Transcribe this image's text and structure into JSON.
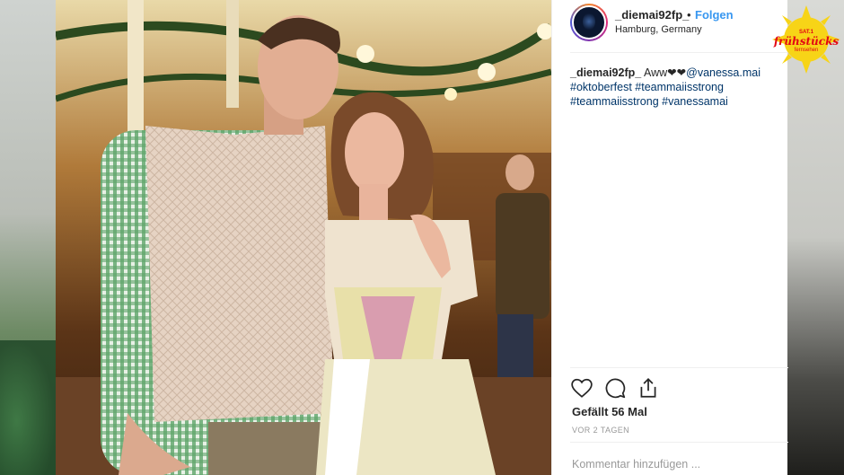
{
  "post": {
    "username": "_diemai92fp_",
    "separator": "•",
    "follow_label": "Folgen",
    "location": "Hamburg, Germany",
    "caption": {
      "username": "_diemai92fp_",
      "text": " Aww❤❤",
      "mention": "@vanessa.mai",
      "hashtags": [
        "#oktoberfest",
        "#teammaiisstrong",
        "#teammaiisstrong",
        "#vanessamai"
      ]
    },
    "likes": "Gefällt 56 Mal",
    "time": "VOR 2 TAGEN",
    "comment_placeholder": "Kommentar hinzufügen ..."
  },
  "logo": {
    "top": "SAT.1",
    "main": "frühstücks",
    "sub": "fernsehen"
  },
  "colors": {
    "follow": "#3897f0",
    "logo_sun": "#f7d417",
    "logo_text": "#e30613"
  },
  "icons": [
    "heart-icon",
    "comment-icon",
    "share-icon"
  ]
}
